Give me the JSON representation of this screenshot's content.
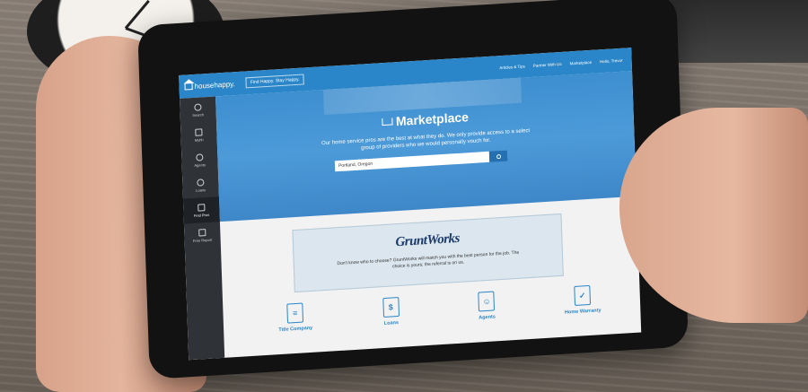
{
  "app": {
    "logo_text": "househappy.",
    "tagline_button": "Find Happy. Stay Happy."
  },
  "topnav": {
    "links": [
      "Articles & Tips",
      "Partner With Us",
      "Marketplace",
      "Hello, Trevor"
    ]
  },
  "sidebar": {
    "items": [
      {
        "label": "Search",
        "icon": "search-icon"
      },
      {
        "label": "Myhh",
        "icon": "home-icon"
      },
      {
        "label": "Agents",
        "icon": "person-icon"
      },
      {
        "label": "Loans",
        "icon": "dollar-icon"
      },
      {
        "label": "Find Pros",
        "icon": "book-icon"
      },
      {
        "label": "Free Report",
        "icon": "report-icon"
      }
    ],
    "active_index": 4
  },
  "hero": {
    "title": "Marketplace",
    "description": "Our home service pros are the best at what they do. We only provide access to a select group of providers who we would personally vouch for.",
    "search_value": "Portland, Oregon"
  },
  "featured": {
    "logo": "GruntWorks",
    "text": "Don't know who to choose? GruntWorks will match you with the best person for the job. The choice is yours; the referral is on us."
  },
  "categories": [
    {
      "label": "Title Company",
      "icon": "document-icon"
    },
    {
      "label": "Loans",
      "icon": "money-icon"
    },
    {
      "label": "Agents",
      "icon": "agent-icon"
    },
    {
      "label": "Home Warranty",
      "icon": "warranty-icon"
    }
  ],
  "colors": {
    "primary": "#2a86c8",
    "sidebar": "#2f3338",
    "featured_bg": "#dbe6ee"
  }
}
